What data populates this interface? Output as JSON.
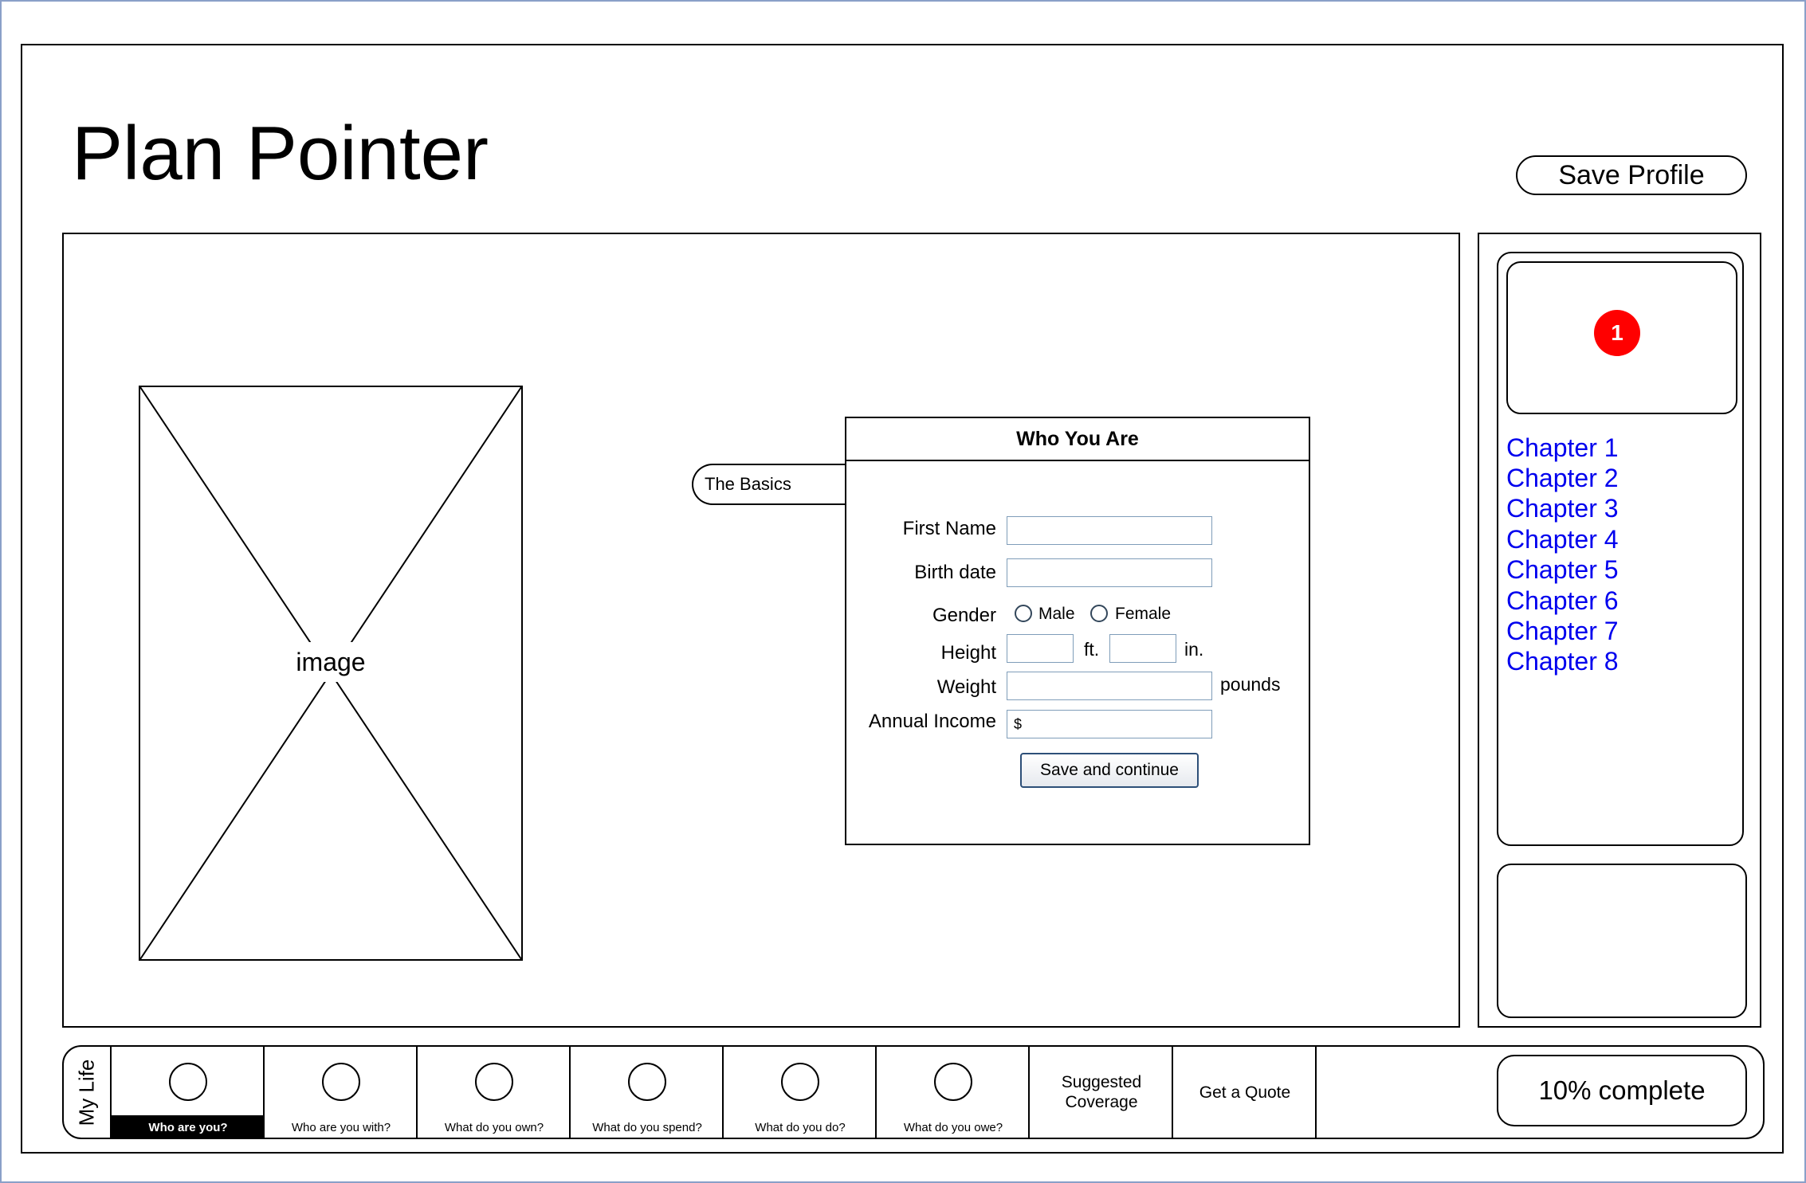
{
  "app": {
    "title": "Plan Pointer",
    "save_profile": "Save Profile"
  },
  "image_placeholder": {
    "label": "image"
  },
  "form": {
    "tab_label": "The Basics",
    "header": "Who You Are",
    "first_name_label": "First Name",
    "first_name_value": "",
    "birth_date_label": "Birth date",
    "birth_date_value": "",
    "gender_label": "Gender",
    "gender_options": [
      "Male",
      "Female"
    ],
    "height_label": "Height",
    "height_ft_unit": "ft.",
    "height_in_unit": "in.",
    "weight_label": "Weight",
    "weight_unit": "pounds",
    "income_label": "Annual Income",
    "income_prefix": "$",
    "submit_label": "Save and continue"
  },
  "sidebar": {
    "badge": "1",
    "chapters": [
      "Chapter 1",
      "Chapter 2",
      "Chapter 3",
      "Chapter 4",
      "Chapter 5",
      "Chapter 6",
      "Chapter 7",
      "Chapter 8"
    ]
  },
  "progress": {
    "section_label": "My Life",
    "steps": [
      "Who are you?",
      "Who are you with?",
      "What do you own?",
      "What do you spend?",
      "What do you do?",
      "What do you owe?"
    ],
    "active_step": "Who are you?",
    "suggested": "Suggested Coverage",
    "quote": "Get a Quote",
    "percent_text": "10% complete",
    "percent_value": 10
  },
  "colors": {
    "link": "#0000ee",
    "badge": "#ff0000",
    "input_border": "#7f9db9",
    "active_step_bg": "#000000"
  }
}
